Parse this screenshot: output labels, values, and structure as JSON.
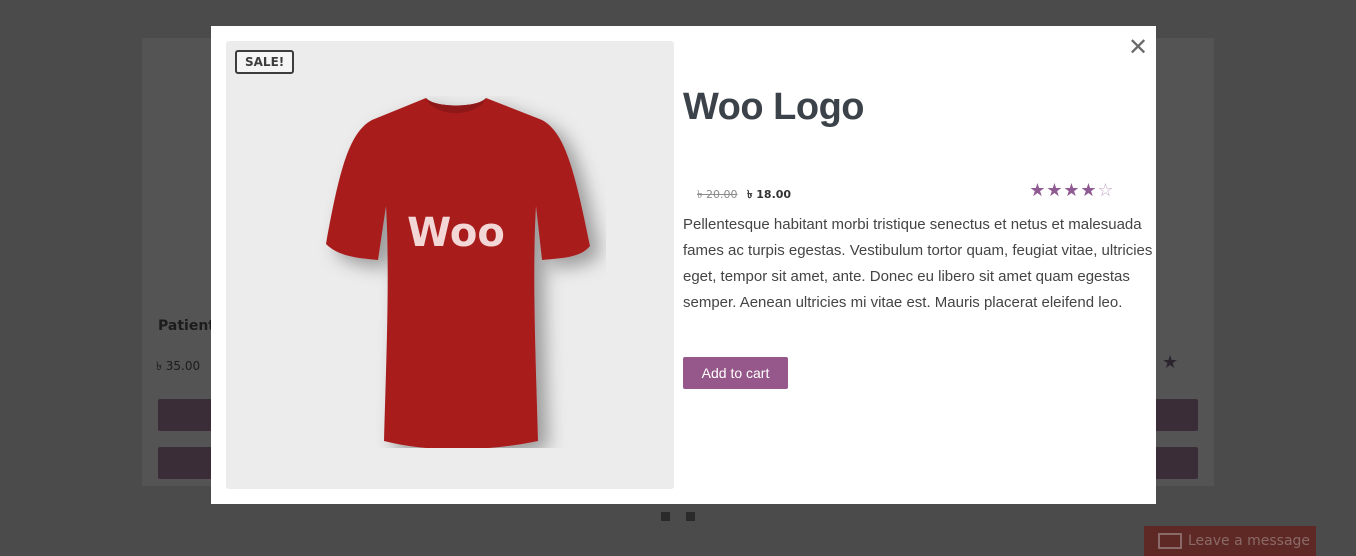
{
  "background": {
    "product_title": "Patient",
    "product_price": "৳ 35.00"
  },
  "chat": {
    "label": "Leave a message"
  },
  "modal": {
    "close_symbol": "✕",
    "sale_badge": "SALE!",
    "shirt_text": "Woo",
    "title": "Woo Logo",
    "price_old": "৳ 20.00",
    "price_new": "৳ 18.00",
    "rating": 4,
    "rating_max": 5,
    "description": "Pellentesque habitant morbi tristique senectus et netus et malesuada fames ac turpis egestas. Vestibulum tortor quam, feugiat vitae, ultricies eget, tempor sit amet, ante. Donec eu libero sit amet quam egestas semper. Aenean ultricies mi vitae est. Mauris placerat eleifend leo.",
    "add_to_cart": "Add to cart"
  },
  "colors": {
    "accent": "#96588a",
    "shirt": "#a81f1f",
    "overlay": "#4b4b4b"
  }
}
